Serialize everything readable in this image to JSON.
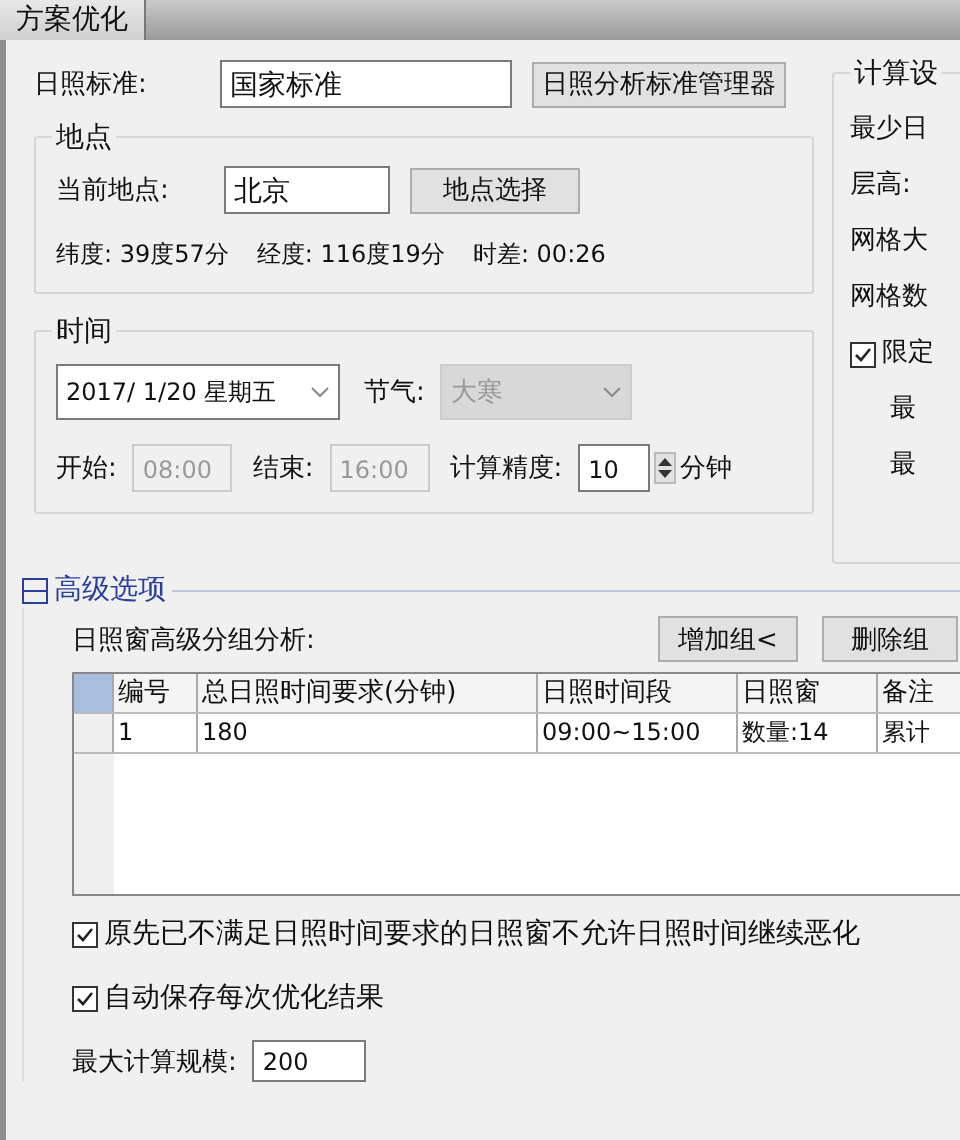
{
  "tab": {
    "label": "方案优化",
    "selected": true
  },
  "standard": {
    "label": "日照标准:",
    "value": "国家标准",
    "button": "日照分析标准管理器"
  },
  "location": {
    "title": "地点",
    "label": "当前地点:",
    "value": "北京",
    "button": "地点选择",
    "info": [
      "纬度: 39度57分",
      "经度: 116度19分",
      "时差: 00:26"
    ]
  },
  "time": {
    "title": "时间",
    "date": "2017/ 1/20 星期五",
    "solar_term_label": "节气:",
    "solar_term": "大寒",
    "solar_term_disabled": true,
    "start_label": "开始:",
    "start": "08:00",
    "start_disabled": true,
    "end_label": "结束:",
    "end": "16:00",
    "end_disabled": true,
    "precision_label": "计算精度:",
    "precision": "10",
    "unit": "分钟"
  },
  "calc": {
    "title": "计算设",
    "items": [
      {
        "kind": "label",
        "text": "最少日"
      },
      {
        "kind": "label",
        "text": "层高:"
      },
      {
        "kind": "label",
        "text": "网格大"
      },
      {
        "kind": "label",
        "text": "网格数"
      },
      {
        "kind": "check",
        "text": "限定",
        "checked": true
      },
      {
        "kind": "sub",
        "text": "最"
      },
      {
        "kind": "sub",
        "text": "最"
      }
    ]
  },
  "advanced": {
    "title": "高级选项",
    "expanded": true,
    "group_label": "日照窗高级分组分析:",
    "buttons": [
      "增加组<",
      "删除组"
    ],
    "table": {
      "columns": [
        "编号",
        "总日照时间要求(分钟)",
        "日照时间段",
        "日照窗",
        "备注"
      ],
      "rows": [
        [
          "1",
          "180",
          "09:00~15:00",
          "数量:14",
          "累计"
        ]
      ]
    },
    "options": [
      {
        "text": "原先已不满足日照时间要求的日照窗不允许日照时间继续恶化",
        "checked": true
      },
      {
        "text": "自动保存每次优化结果",
        "checked": true
      }
    ],
    "max_label": "最大计算规模:",
    "max_value": "200"
  }
}
